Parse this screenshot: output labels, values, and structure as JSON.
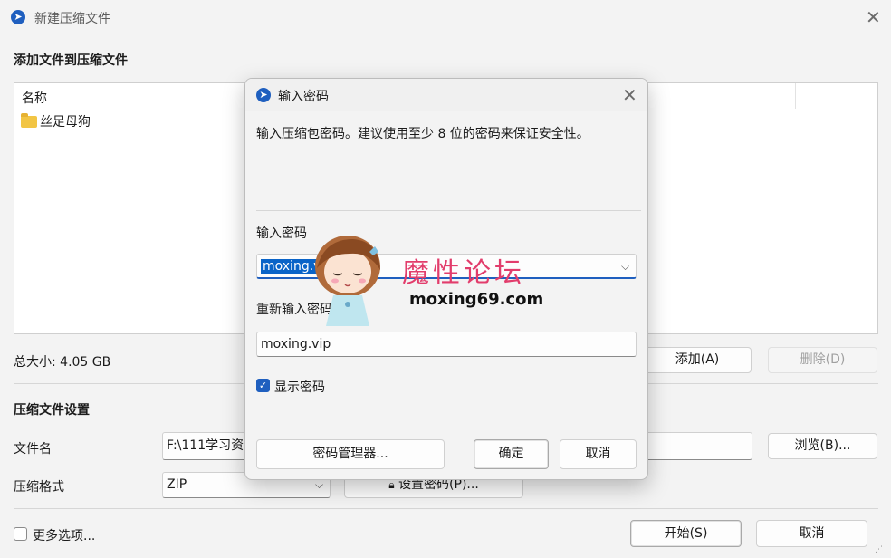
{
  "window": {
    "title": "新建压缩文件",
    "section_add_title": "添加文件到压缩文件",
    "list_header_name": "名称",
    "list_item": "丝足母狗",
    "total_size": "总大小: 4.05 GB",
    "add_button": "添加(A)",
    "delete_button": "删除(D)",
    "settings_title": "压缩文件设置",
    "filename_label": "文件名",
    "filename_value": "F:\\111学习资",
    "browse_button": "浏览(B)...",
    "format_label": "压缩格式",
    "format_value": "ZIP",
    "set_password_button": "设置密码(P)...",
    "more_options_label": "更多选项...",
    "start_button": "开始(S)",
    "cancel_button": "取消"
  },
  "dialog": {
    "title": "输入密码",
    "description": "输入压缩包密码。建议使用至少 8 位的密码来保证安全性。",
    "password_label": "输入密码",
    "password_value": "moxing.vi",
    "reenter_label": "重新输入密码",
    "reenter_value": "moxing.vip",
    "show_password_label": "显示密码",
    "show_password_checked": true,
    "password_manager_button": "密码管理器...",
    "ok_button": "确定",
    "cancel_button": "取消"
  },
  "watermark": {
    "title": "魔性论坛",
    "url": "moxing69.com"
  },
  "colors": {
    "accent": "#1f5fbf",
    "selection": "#0a64c8",
    "watermark": "#e23d6c"
  }
}
